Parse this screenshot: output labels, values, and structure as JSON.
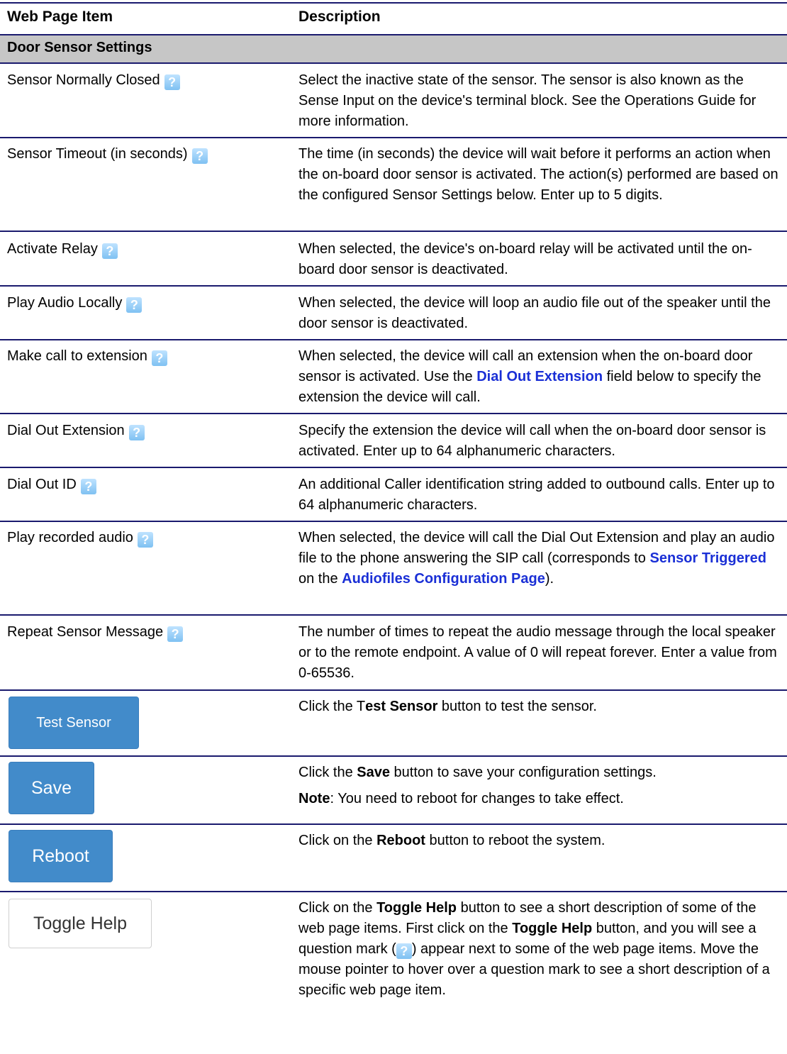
{
  "header": {
    "col1": "Web Page Item",
    "col2": "Description"
  },
  "section_title": "Door Sensor Settings",
  "help_glyph": "?",
  "rows": [
    {
      "item": "Sensor Normally Closed",
      "desc": "Select the inactive state of the sensor. The sensor is also known as the Sense Input on the device's terminal block. See the Operations Guide for more information."
    },
    {
      "item": "Sensor Timeout (in seconds)",
      "desc": "The time (in seconds) the device will wait before it performs an action when the on-board door sensor is activated. The action(s) performed are based on the configured Sensor Settings below. Enter up to 5 digits."
    },
    {
      "item": "Activate Relay",
      "desc": "When selected, the device's on-board relay will be activated until the on-board door sensor is deactivated."
    },
    {
      "item": "Play Audio Locally",
      "desc": "When selected, the device will loop an audio file out of the speaker until the door sensor is deactivated."
    },
    {
      "item": "Make call to extension",
      "desc_a": "When selected, the device will call an extension when the on-board door sensor is activated. Use the ",
      "desc_link": "Dial Out Extension",
      "desc_b": " field below to specify the extension the device will call."
    },
    {
      "item": "Dial Out Extension",
      "desc": "Specify the extension the device will call when the on-board door sensor is activated. Enter up to 64 alphanumeric characters."
    },
    {
      "item": "Dial Out ID",
      "desc": "An additional Caller identification string added to outbound calls. Enter up to 64 alphanumeric characters."
    },
    {
      "item": "Play recorded audio",
      "desc_a": "When selected, the device will call the Dial Out Extension and play an audio file to the phone answering the SIP call (corresponds to ",
      "desc_link1": "Sensor Triggered",
      "desc_mid": " on the ",
      "desc_link2": "Audiofiles Configuration Page",
      "desc_b": ")."
    },
    {
      "item": "Repeat Sensor Message",
      "desc": "The number of times to repeat the audio message through the local speaker or to the remote endpoint. A value of 0 will repeat forever. Enter a value from 0-65536."
    }
  ],
  "buttons": {
    "test": {
      "label": "Test Sensor",
      "desc_a": "Click the T",
      "desc_bold": "est Sensor",
      "desc_b": " button to test the sensor."
    },
    "save": {
      "label": "Save",
      "desc_a": "Click the ",
      "desc_bold": "Save",
      "desc_b": " button to save your configuration settings.",
      "note_bold": "Note",
      "note_rest": ": You need to reboot for changes to take effect."
    },
    "reboot": {
      "label": "Reboot",
      "desc_a": "Click on the ",
      "desc_bold": "Reboot",
      "desc_b": " button to reboot the system."
    },
    "toggle": {
      "label": "Toggle Help",
      "desc_a": "Click on the ",
      "desc_bold1": "Toggle Help",
      "desc_b": " button to see a short description of some of the web page items. First click on the ",
      "desc_bold2": "Toggle Help",
      "desc_c": " button, and you will see a question mark (",
      "desc_d": ") appear next to some of the web page items. Move the mouse pointer to hover over a question mark to see a short description of a specific web page item."
    }
  }
}
